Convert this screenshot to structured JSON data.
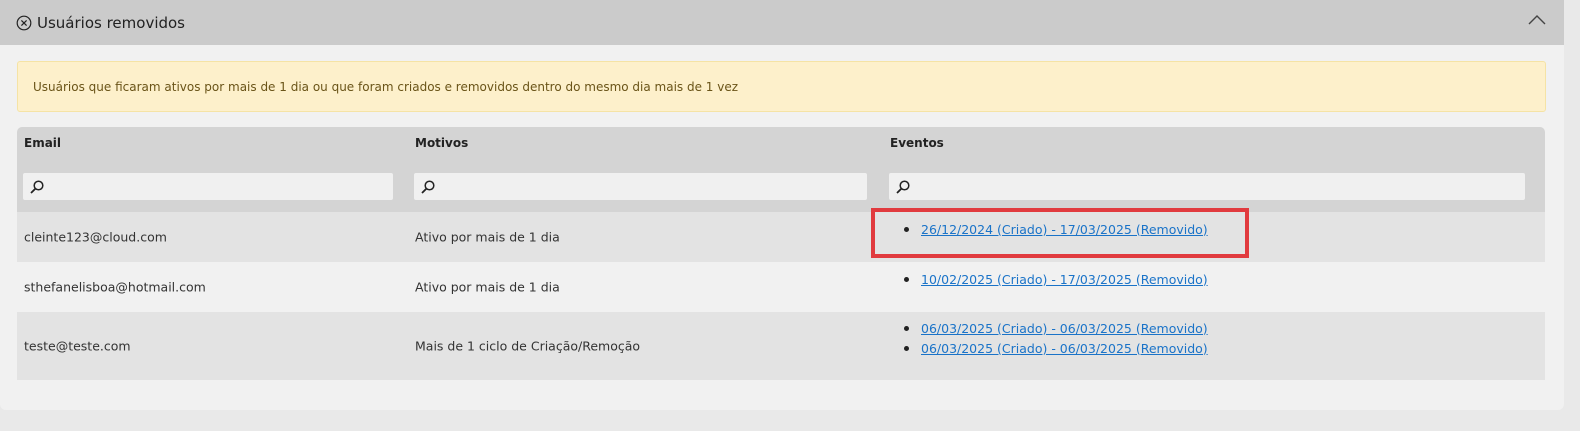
{
  "panel": {
    "title": "Usuários removidos",
    "notice": "Usuários que ficaram ativos por mais de 1 dia ou que foram criados e removidos dentro do mesmo dia mais de 1 vez"
  },
  "table": {
    "headers": {
      "email": "Email",
      "motivos": "Motivos",
      "eventos": "Eventos"
    },
    "rows": [
      {
        "email": "cleinte123@cloud.com",
        "motivo": "Ativo por mais de 1 dia",
        "eventos": [
          "26/12/2024 (Criado) - 17/03/2025 (Removido)"
        ]
      },
      {
        "email": "sthefanelisboa@hotmail.com",
        "motivo": "Ativo por mais de 1 dia",
        "eventos": [
          "10/02/2025 (Criado) - 17/03/2025 (Removido)"
        ]
      },
      {
        "email": "teste@teste.com",
        "motivo": "Mais de 1 ciclo de Criação/Remoção",
        "eventos": [
          "06/03/2025 (Criado) - 06/03/2025 (Removido)",
          "06/03/2025 (Criado) - 06/03/2025 (Removido)"
        ]
      }
    ]
  },
  "colors": {
    "highlight": "#e13b3f",
    "link": "#1a73c8",
    "header": "#cbcbcb",
    "notice_bg": "#fdf0cb"
  },
  "icons": {
    "title": "circle-x-icon",
    "collapse": "chevron-up-icon",
    "filter": "search-icon"
  }
}
